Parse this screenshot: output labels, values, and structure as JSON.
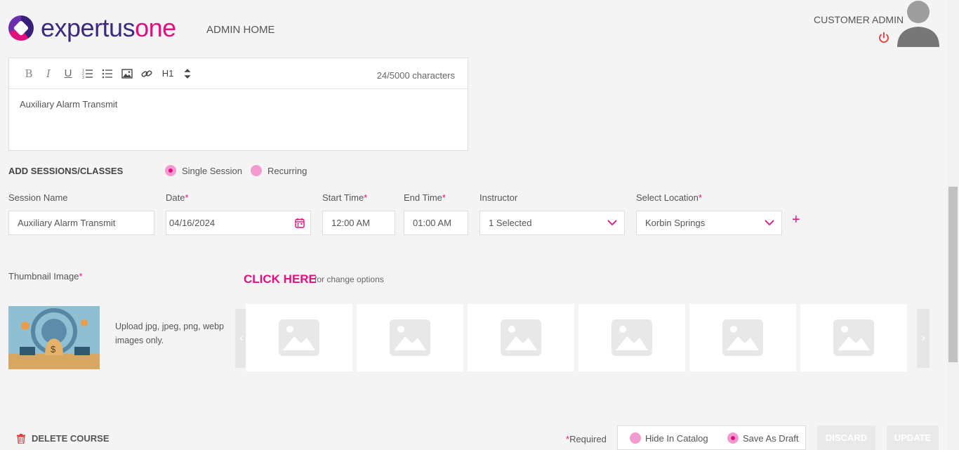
{
  "header": {
    "logo_part1": "expertus",
    "logo_part2": "one",
    "nav_admin_home": "ADMIN HOME",
    "user_role": "CUSTOMER ADMIN"
  },
  "editor": {
    "toolbar": {
      "bold": "B",
      "italic": "I",
      "underline": "U",
      "heading": "H1"
    },
    "char_count": "24/5000 characters",
    "content": "Auxiliary Alarm Transmit"
  },
  "sessions": {
    "title": "ADD SESSIONS/CLASSES",
    "mode_single": "Single Session",
    "mode_recurring": "Recurring",
    "selected_mode": "Single Session",
    "labels": {
      "session_name": "Session Name",
      "date": "Date",
      "start_time": "Start Time",
      "end_time": "End Time",
      "instructor": "Instructor",
      "location": "Select Location"
    },
    "required_mark": "*",
    "values": {
      "session_name": "Auxiliary Alarm Transmit",
      "date": "04/16/2024",
      "start_time": "12:00 AM",
      "end_time": "01:00 AM",
      "instructor": "1 Selected",
      "location": "Korbin Springs"
    },
    "add_symbol": "+"
  },
  "thumbnail": {
    "label": "Thumbnail Image",
    "click_here": "CLICK HERE",
    "change_options": "for change options",
    "upload_hint": "Upload jpg, jpeg, png, webp images only.",
    "gallery_count": 6
  },
  "footer": {
    "delete_course": "DELETE COURSE",
    "required_note": "Required",
    "hide_in_catalog": "Hide In Catalog",
    "save_as_draft": "Save As Draft",
    "discard": "DISCARD",
    "update": "UPDATE"
  },
  "colors": {
    "accent": "#e0117f",
    "accent_light": "#f39bd0",
    "brand_dark": "#3b2a7e",
    "power_icon": "#e53935"
  }
}
